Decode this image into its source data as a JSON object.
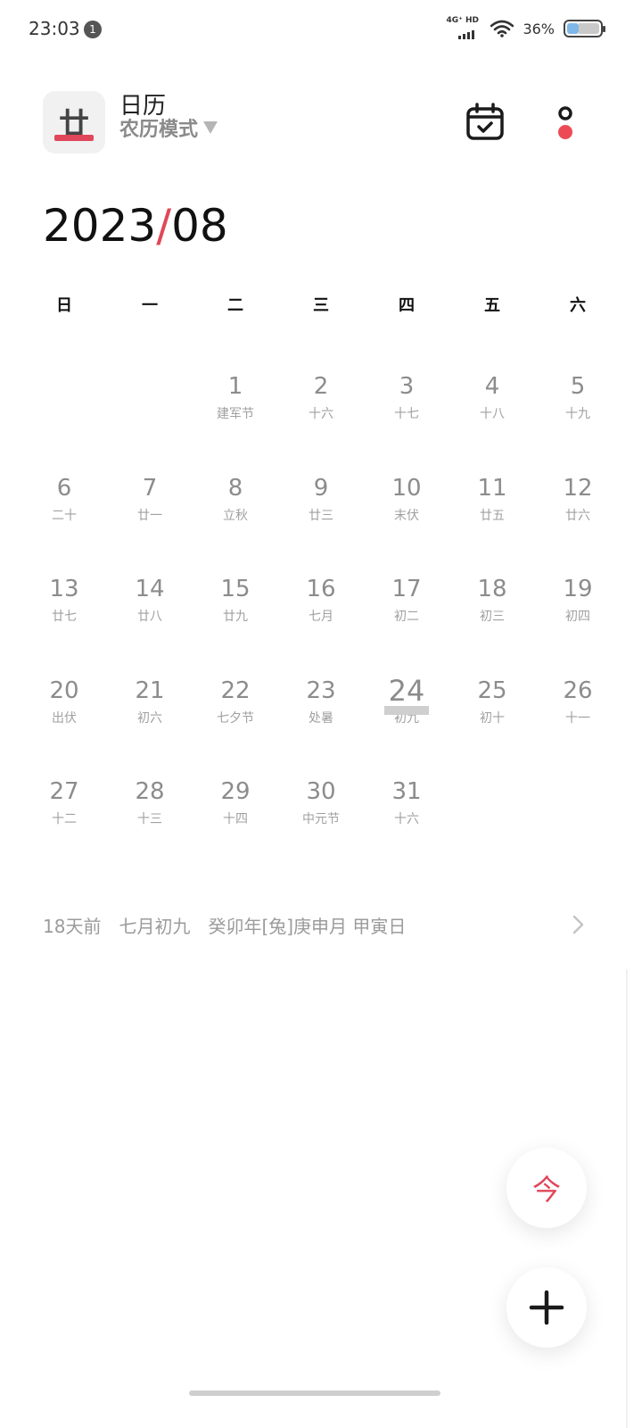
{
  "status_bar": {
    "time": "23:03",
    "notification_count": "1",
    "network_label": "4G⁺ HD",
    "battery_percent": "36%",
    "battery_level": 0.36
  },
  "header": {
    "logo_glyph": "廿",
    "title": "日历",
    "mode": "农历模式",
    "icons": [
      "calendar-check-icon",
      "more-dots-icon"
    ],
    "accent_color": "#e0475a"
  },
  "month_heading": {
    "year": "2023",
    "separator": "/",
    "month": "08"
  },
  "weekdays": [
    "日",
    "一",
    "二",
    "三",
    "四",
    "五",
    "六"
  ],
  "calendar": {
    "today": "24",
    "weeks": [
      [
        {
          "day": "",
          "sub": ""
        },
        {
          "day": "",
          "sub": ""
        },
        {
          "day": "1",
          "sub": "建军节"
        },
        {
          "day": "2",
          "sub": "十六"
        },
        {
          "day": "3",
          "sub": "十七"
        },
        {
          "day": "4",
          "sub": "十八"
        },
        {
          "day": "5",
          "sub": "十九"
        }
      ],
      [
        {
          "day": "6",
          "sub": "二十"
        },
        {
          "day": "7",
          "sub": "廿一"
        },
        {
          "day": "8",
          "sub": "立秋"
        },
        {
          "day": "9",
          "sub": "廿三"
        },
        {
          "day": "10",
          "sub": "末伏"
        },
        {
          "day": "11",
          "sub": "廿五"
        },
        {
          "day": "12",
          "sub": "廿六"
        }
      ],
      [
        {
          "day": "13",
          "sub": "廿七"
        },
        {
          "day": "14",
          "sub": "廿八"
        },
        {
          "day": "15",
          "sub": "廿九"
        },
        {
          "day": "16",
          "sub": "七月"
        },
        {
          "day": "17",
          "sub": "初二"
        },
        {
          "day": "18",
          "sub": "初三"
        },
        {
          "day": "19",
          "sub": "初四"
        }
      ],
      [
        {
          "day": "20",
          "sub": "出伏"
        },
        {
          "day": "21",
          "sub": "初六"
        },
        {
          "day": "22",
          "sub": "七夕节"
        },
        {
          "day": "23",
          "sub": "处暑"
        },
        {
          "day": "24",
          "sub": "初九"
        },
        {
          "day": "25",
          "sub": "初十"
        },
        {
          "day": "26",
          "sub": "十一"
        }
      ],
      [
        {
          "day": "27",
          "sub": "十二"
        },
        {
          "day": "28",
          "sub": "十三"
        },
        {
          "day": "29",
          "sub": "十四"
        },
        {
          "day": "30",
          "sub": "中元节"
        },
        {
          "day": "31",
          "sub": "十六"
        },
        {
          "day": "",
          "sub": ""
        },
        {
          "day": "",
          "sub": ""
        }
      ]
    ]
  },
  "info_line": {
    "text": "18天前　七月初九　癸卯年[兔]庚申月 甲寅日"
  },
  "fab": {
    "today_label": "今"
  }
}
